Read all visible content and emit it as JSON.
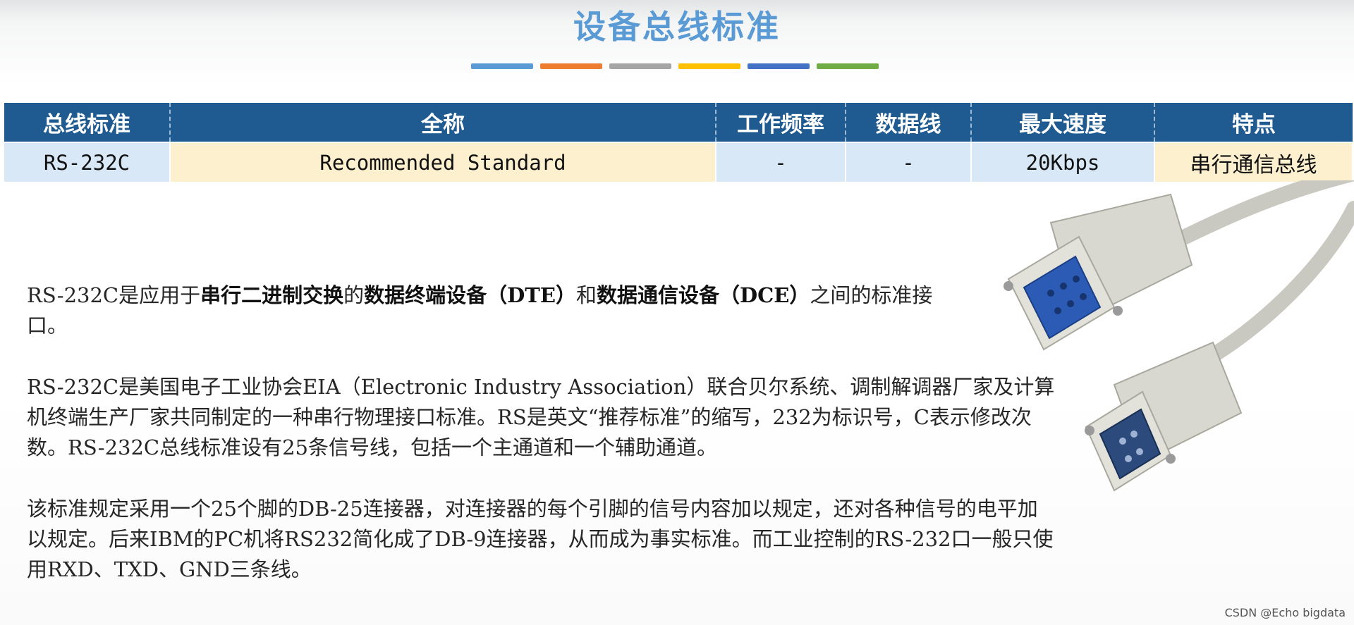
{
  "slide": {
    "title": "设备总线标准",
    "accent_bar_colors": [
      "#5b9bd5",
      "#ed7d31",
      "#a5a5a5",
      "#ffc000",
      "#4472c4",
      "#70ad47"
    ]
  },
  "table": {
    "headers": [
      "总线标准",
      "全称",
      "工作频率",
      "数据线",
      "最大速度",
      "特点"
    ],
    "row": {
      "standard": "RS-232C",
      "full_name": "Recommended Standard",
      "frequency": "-",
      "data_lines": "-",
      "max_speed": "20Kbps",
      "feature": "串行通信总线"
    }
  },
  "paragraphs": {
    "p1": {
      "a": "RS-232C是应用于",
      "b": "串行二进制交换",
      "c": "的",
      "d": "数据终端设备（DTE）",
      "e": "和",
      "f": "数据通信设备（DCE）",
      "g": "之间的标准接口。"
    },
    "p2": "RS-232C是美国电子工业协会EIA（Electronic Industry Association）联合贝尔系统、调制解调器厂家及计算机终端生产厂家共同制定的一种串行物理接口标准。RS是英文“推荐标准”的缩写，232为标识号，C表示修改次数。RS-232C总线标准设有25条信号线，包括一个主通道和一个辅助通道。",
    "p3": "该标准规定采用一个25个脚的DB-25连接器，对连接器的每个引脚的信号内容加以规定，还对各种信号的电平加以规定。后来IBM的PC机将RS232简化成了DB-9连接器，从而成为事实标准。而工业控制的RS-232口一般只使用RXD、TXD、GND三条线。"
  },
  "watermark": "CSDN @Echo bigdata"
}
